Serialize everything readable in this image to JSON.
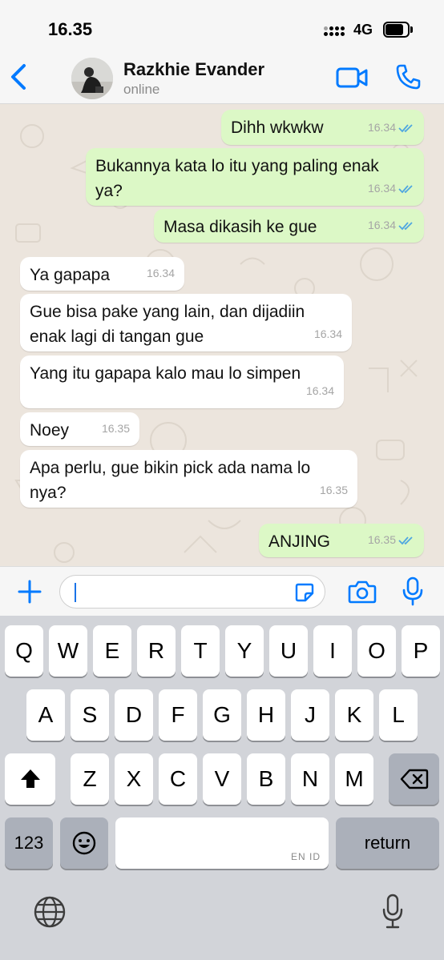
{
  "status_bar": {
    "time": "16.35",
    "network": "4G",
    "icons": [
      "cellular-signal-icon",
      "battery-icon"
    ]
  },
  "header": {
    "contact_name": "Razkhie Evander",
    "contact_status": "online",
    "icons": [
      "back-chevron-icon",
      "avatar-photo",
      "video-call-icon",
      "phone-call-icon"
    ]
  },
  "messages": [
    {
      "direction": "out",
      "text": "Dihh wkwkw",
      "time": "16.34",
      "read": true
    },
    {
      "direction": "out",
      "text": "Bukannya kata lo itu yang paling enak\nya?",
      "time": "16.34",
      "read": true
    },
    {
      "direction": "out",
      "text": "Masa dikasih ke gue",
      "time": "16.34",
      "read": true
    },
    {
      "direction": "in",
      "text": "Ya gapapa",
      "time": "16.34"
    },
    {
      "direction": "in",
      "text": "Gue bisa pake yang lain, dan dijadiin\nenak lagi di tangan gue",
      "time": "16.34"
    },
    {
      "direction": "in",
      "text": "Yang itu gapapa kalo mau lo simpen",
      "time": "16.34"
    },
    {
      "direction": "in",
      "text": "Noey",
      "time": "16.35"
    },
    {
      "direction": "in",
      "text": "Apa perlu, gue bikin pick ada nama lo\nnya?",
      "time": "16.35"
    },
    {
      "direction": "out",
      "text": "ANJING",
      "time": "16.35",
      "read": true
    }
  ],
  "composer": {
    "value": "",
    "icons": [
      "plus-icon",
      "sticker-icon",
      "camera-icon",
      "microphone-icon"
    ]
  },
  "keyboard": {
    "row1": [
      "Q",
      "W",
      "E",
      "R",
      "T",
      "Y",
      "U",
      "I",
      "O",
      "P"
    ],
    "row2": [
      "A",
      "S",
      "D",
      "F",
      "G",
      "H",
      "J",
      "K",
      "L"
    ],
    "row3": [
      "Z",
      "X",
      "C",
      "V",
      "B",
      "N",
      "M"
    ],
    "numbers_label": "123",
    "space_hint": "EN ID",
    "return_label": "return",
    "icons": [
      "shift-icon",
      "backspace-icon",
      "emoji-icon",
      "globe-icon",
      "dictation-mic-icon"
    ]
  },
  "colors": {
    "accent": "#007aff",
    "outgoing_bubble": "#dcf8c6",
    "incoming_bubble": "#ffffff",
    "chat_background": "#ece5dd",
    "read_ticks": "#4fa6e0"
  }
}
